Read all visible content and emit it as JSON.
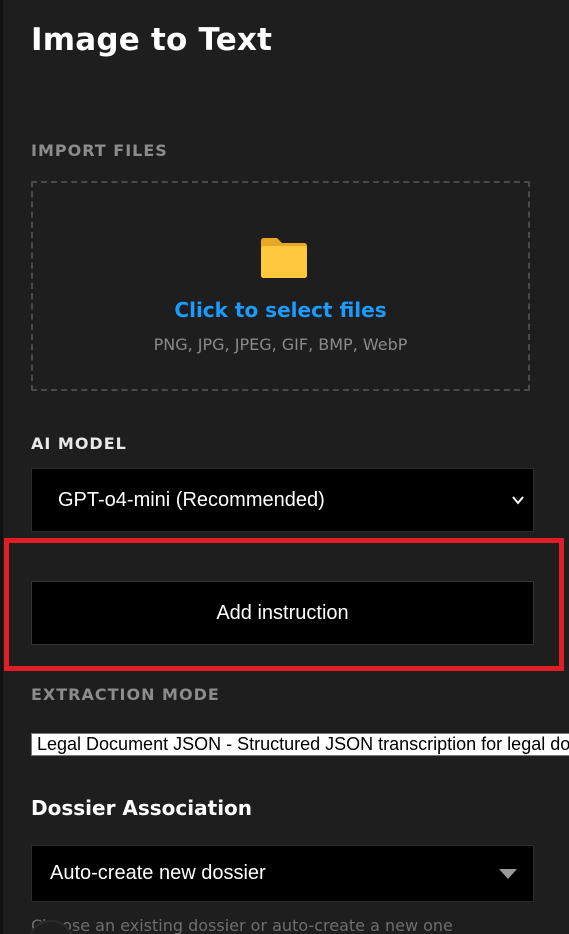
{
  "header": {
    "title": "Image to Text"
  },
  "import": {
    "label": "IMPORT FILES",
    "dropzone_title": "Click to select files",
    "dropzone_formats": "PNG, JPG, JPEG, GIF, BMP, WebP",
    "icon": "folder-icon"
  },
  "model": {
    "label": "AI MODEL",
    "selected": "GPT-o4-mini (Recommended)",
    "icon": "chevron-down-icon"
  },
  "instruction": {
    "button_label": "Add instruction",
    "highlight_color": "#e01e25"
  },
  "extraction": {
    "label": "EXTRACTION MODE",
    "selected": "Legal Document JSON - Structured JSON transcription for legal documents"
  },
  "dossier": {
    "label": "Dossier Association",
    "selected": "Auto-create new dossier",
    "hint": "Choose an existing dossier or auto-create a new one"
  },
  "colors": {
    "background": "#1e1e1e",
    "accent": "#1a9cff",
    "muted_label": "#8c8c8c",
    "folder": "#ffc83d"
  }
}
